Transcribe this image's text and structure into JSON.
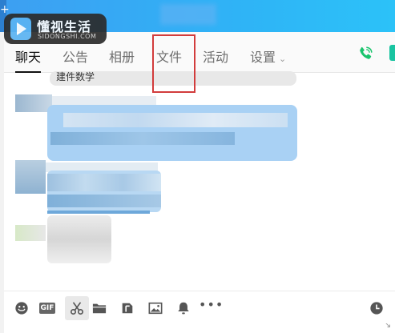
{
  "brand": {
    "name": "懂视生活",
    "domain": "SIDONGSHI.COM"
  },
  "tabs": [
    {
      "label": "聊天",
      "active": true
    },
    {
      "label": "公告"
    },
    {
      "label": "相册"
    },
    {
      "label": "文件"
    },
    {
      "label": "活动"
    },
    {
      "label": "设置",
      "dropdown": true
    }
  ],
  "chat": {
    "system_message": "建件数学"
  },
  "toolbar": {
    "gif_label": "GIF",
    "more_label": "•••"
  },
  "icons": [
    "plus-icon",
    "phone-icon",
    "emoji-icon",
    "gif-icon",
    "scissors-icon",
    "folder-icon",
    "screenshot-icon",
    "image-icon",
    "bell-icon",
    "more-icon",
    "clock-icon",
    "resize-icon",
    "chevron-down-icon"
  ],
  "colors": {
    "topbar": "#3da4f4",
    "highlight": "#d23c3c",
    "phone": "#19c46c",
    "bubble": "#a9d1f4"
  }
}
